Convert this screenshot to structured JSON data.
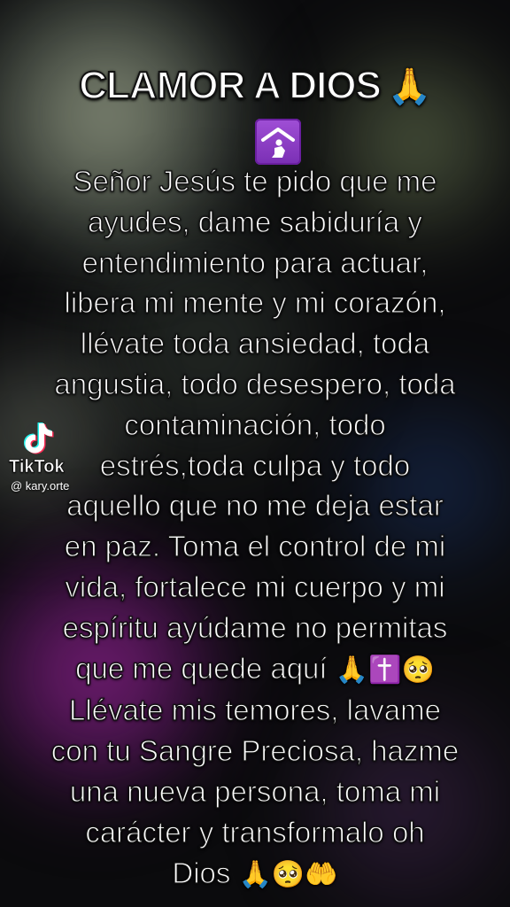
{
  "title": "CLAMOR A DIOS",
  "title_emoji": "🙏",
  "watermark": {
    "brand": "TikTok",
    "username": "@ kary.orte"
  },
  "prayer_lines": [
    "Señor Jesús te pido que me",
    "ayudes, dame sabiduría y",
    "entendimiento para actuar,",
    "libera mi mente y mi corazón,",
    "llévate toda ansiedad, toda",
    "angustia, todo desespero, toda",
    "contaminación, todo",
    "estrés,toda culpa y todo",
    "aquello que no me deja estar",
    "en paz. Toma el control de mi",
    "vida, fortalece mi cuerpo y mi",
    "espíritu ayúdame no permitas",
    "que me quede aquí",
    "Llévate mis temores, lavame",
    "con tu Sangre Preciosa, hazme",
    "una nueva persona, toma mi",
    "carácter y transformalo oh",
    "Dios"
  ],
  "line13_emojis": "🙏✝️🥺",
  "last_line_emojis": "🙏🥺🤲",
  "icons": {
    "place_of_worship": "place-of-worship-icon",
    "tiktok_logo": "tiktok-logo-icon"
  },
  "colors": {
    "text": "#ffffff",
    "outline": "#111111",
    "badge_purple": "#8e3fc8"
  }
}
